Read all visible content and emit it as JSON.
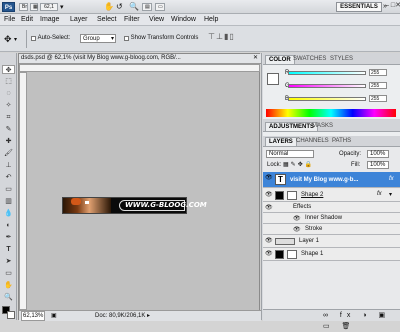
{
  "app": {
    "logo": "Ps",
    "workspace": "ESSENTIALS",
    "zoom_box": "62,1",
    "window_buttons": [
      "–",
      "□",
      "✕"
    ]
  },
  "menu": [
    "File",
    "Edit",
    "Image",
    "Layer",
    "Select",
    "Filter",
    "View",
    "Window",
    "Help"
  ],
  "options": {
    "auto_select_label": "Auto-Select:",
    "auto_select_value": "Group",
    "show_transform_label": "Show Transform Controls"
  },
  "document": {
    "tab_title": "dsds.psd @ 62,1% (visit My Blog   www.g-bloog.com, RGB/...",
    "banner_text": "WWW.G-BLOOG.COM",
    "zoom": "62,13%",
    "doc_size": "Doc: 80,9K/206,1K"
  },
  "color_panel": {
    "tabs": [
      "COLOR",
      "SWATCHES",
      "STYLES"
    ],
    "channels": [
      {
        "label": "R",
        "value": "255"
      },
      {
        "label": "G",
        "value": "255"
      },
      {
        "label": "B",
        "value": "255"
      }
    ]
  },
  "adjust_panel": {
    "tabs": [
      "ADJUSTMENTS",
      "MASKS"
    ]
  },
  "layers_panel": {
    "tabs": [
      "LAYERS",
      "CHANNELS",
      "PATHS"
    ],
    "blend_mode": "Normal",
    "opacity_label": "Opacity:",
    "opacity": "100%",
    "lock_label": "Lock:",
    "fill_label": "Fill:",
    "fill": "100%",
    "layers": [
      {
        "name": "visit My Blog   www.g-b...",
        "fx": "fx"
      },
      {
        "name": "Shape 2",
        "fx": "fx"
      },
      {
        "name": "Effects",
        "fx": ""
      },
      {
        "name": "Inner Shadow",
        "fx": ""
      },
      {
        "name": "Stroke",
        "fx": ""
      },
      {
        "name": "Layer 1",
        "fx": ""
      },
      {
        "name": "Shape 1",
        "fx": ""
      }
    ]
  },
  "colors": {
    "accent": "#3a7fd5",
    "selected_layer": "#3d84d8"
  }
}
